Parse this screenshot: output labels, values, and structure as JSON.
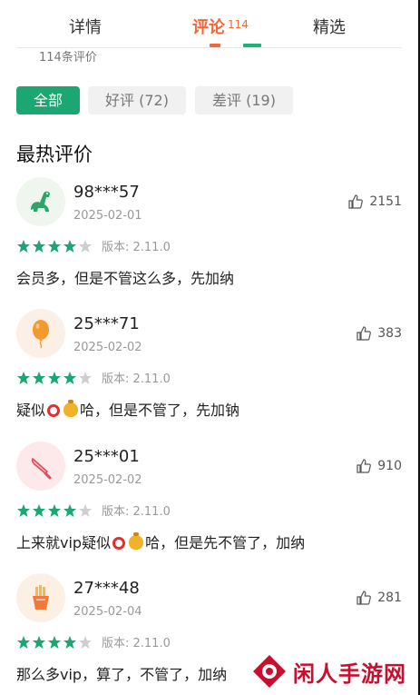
{
  "tabs": {
    "details": "详情",
    "comments": "评论",
    "comments_badge": "114",
    "featured": "精选"
  },
  "review_count": "114条评价",
  "filters": {
    "all": "全部",
    "positive": "好评 (72)",
    "negative": "差评 (19)"
  },
  "section_title": "最热评价",
  "reviews": [
    {
      "user": "98***57",
      "date": "2025-02-01",
      "likes": "2151",
      "version": "版本: 2.11.0",
      "rating": 4,
      "content": "会员多，但是不管这么多，先加纳",
      "avatar": "dinosaur-icon"
    },
    {
      "user": "25***71",
      "date": "2025-02-02",
      "likes": "383",
      "version": "版本: 2.11.0",
      "rating": 4,
      "content_a": "疑似",
      "content_b": "哈，但是不管了，先加钠",
      "avatar": "balloon-icon"
    },
    {
      "user": "25***01",
      "date": "2025-02-02",
      "likes": "910",
      "version": "版本: 2.11.0",
      "rating": 4,
      "content_a": "上来就vip疑似",
      "content_b": "哈，但是先不管了，加纳",
      "avatar": "knife-icon"
    },
    {
      "user": "27***48",
      "date": "2025-02-04",
      "likes": "281",
      "version": "版本: 2.11.0",
      "rating": 4,
      "content": "那么多vip，算了，不管了，加纳",
      "avatar": "fries-icon"
    }
  ],
  "watermark": "闲人手游网",
  "colors": {
    "accent_green": "#1ba672",
    "accent_orange": "#ea6a3c",
    "star": "#1ba672",
    "star_empty": "#cfcfcf"
  }
}
